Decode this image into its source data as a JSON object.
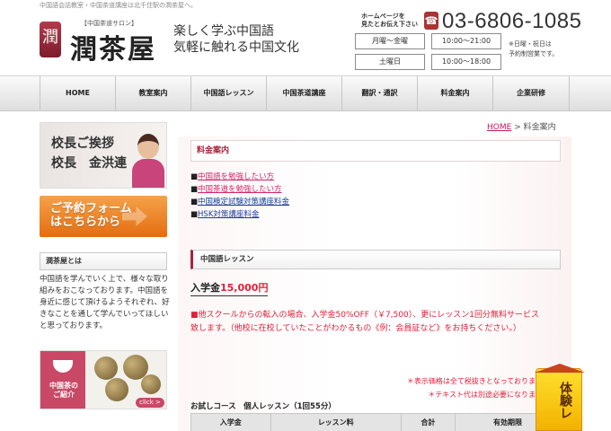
{
  "topline": "中国語会話教室・中国茶道講座は北千住駅の潤茶屋へ。",
  "logo": {
    "mark": "潤",
    "subtitle": "【中国茶道サロン】",
    "name": "潤茶屋"
  },
  "tagline": {
    "line1": "楽しく学ぶ中国語",
    "line2": "気軽に触れる中国文化"
  },
  "contact": {
    "label_line1": "ホームページを",
    "label_line2": "見たとお伝え下さい",
    "phone": "03-6806-1085"
  },
  "hours": [
    {
      "day": "月曜〜金曜",
      "time": "10:00〜21:00"
    },
    {
      "day": "土曜日",
      "time": "10:00〜18:00"
    }
  ],
  "hours_note": {
    "line1": "※日曜・祝日は",
    "line2": "予約制営業です。"
  },
  "nav": [
    "HOME",
    "教室案内",
    "中国語レッスン",
    "中国茶道講座",
    "翻訳・通訳",
    "料金案内",
    "企業研修"
  ],
  "sidebar": {
    "principal": {
      "line1": "校長ご挨拶",
      "line2": "校長　金洪連"
    },
    "reserve": {
      "line1": "ご予約フォーム",
      "line2": "はこちらから"
    },
    "about_heading": "潤茶屋とは",
    "about_text": "中国語を学んでいく上で、様々な取り組みをおこなっております。中国語を身近に感じて頂けるようそれぞれ、好きなことを通して学んでいってほしいと思っております。",
    "tea": {
      "line1": "中国茶の",
      "line2": "ご紹介",
      "click": "click >"
    }
  },
  "breadcrumb": {
    "home": "HOME",
    "sep": ">",
    "current": "料金案内"
  },
  "page_title": "料金案内",
  "links": [
    {
      "label": "中国語を勉強したい方",
      "style": "pink"
    },
    {
      "label": "中国茶道を勉強したい方",
      "style": "pink"
    },
    {
      "label": "中国検定試験対策講座料金",
      "style": "blue"
    },
    {
      "label": "HSK対策講座料金",
      "style": "blue"
    }
  ],
  "section": {
    "title": "中国語レッスン",
    "entrance_label": "入学金",
    "entrance_fee": "15,000円",
    "discount_line1": "■他スクールからの転入の場合、入学金50%OFF（￥7,500）、更にレッスン1回分無料サービス",
    "discount_line2": "致します。（他校に在校していたことがわかるもの《例：会員証など》をお持ちください。）",
    "note1": "＊表示価格は全て税抜きとなっております",
    "note2": "＊テキスト代は別途必要になります",
    "trial_title": "お試しコース　個人レッスン（1回55分）",
    "table_headers": [
      "入学金",
      "レッスン料",
      "合計",
      "有効期限"
    ]
  },
  "trial_tag": "体験レ"
}
